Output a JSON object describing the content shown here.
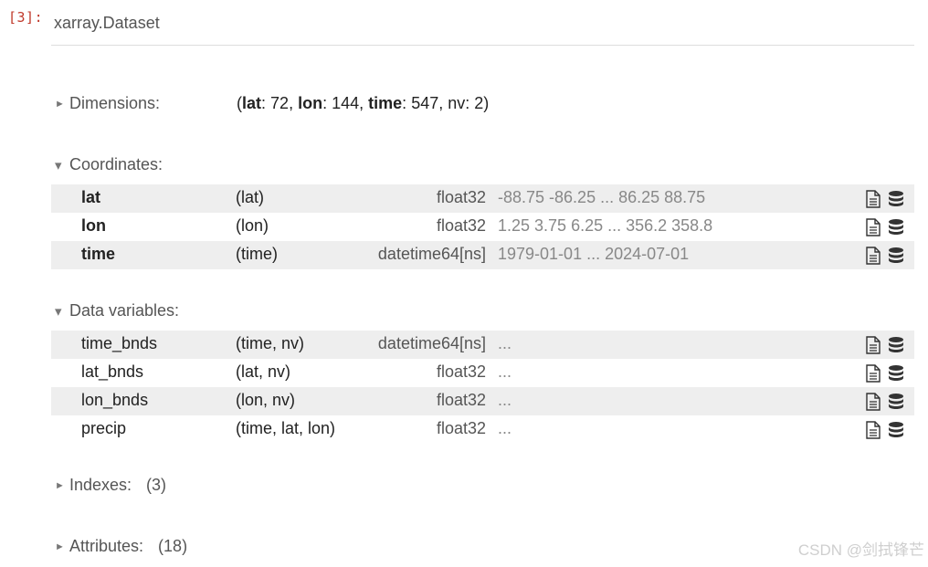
{
  "prompt": "[3]:",
  "dataset_title": "xarray.Dataset",
  "dimensions": {
    "label": "Dimensions:",
    "items": [
      {
        "name": "lat",
        "value": "72"
      },
      {
        "name": "lon",
        "value": "144"
      },
      {
        "name": "time",
        "value": "547"
      },
      {
        "name": "nv",
        "value": "2"
      }
    ]
  },
  "coordinates": {
    "label": "Coordinates:",
    "rows": [
      {
        "name": "lat",
        "dims": "(lat)",
        "dtype": "float32",
        "preview": "-88.75 -86.25 ... 86.25 88.75"
      },
      {
        "name": "lon",
        "dims": "(lon)",
        "dtype": "float32",
        "preview": "1.25 3.75 6.25 ... 356.2 358.8"
      },
      {
        "name": "time",
        "dims": "(time)",
        "dtype": "datetime64[ns]",
        "preview": "1979-01-01 ... 2024-07-01"
      }
    ]
  },
  "data_variables": {
    "label": "Data variables:",
    "rows": [
      {
        "name": "time_bnds",
        "dims": "(time, nv)",
        "dtype": "datetime64[ns]",
        "preview": "..."
      },
      {
        "name": "lat_bnds",
        "dims": "(lat, nv)",
        "dtype": "float32",
        "preview": "..."
      },
      {
        "name": "lon_bnds",
        "dims": "(lon, nv)",
        "dtype": "float32",
        "preview": "..."
      },
      {
        "name": "precip",
        "dims": "(time, lat, lon)",
        "dtype": "float32",
        "preview": "..."
      }
    ]
  },
  "indexes": {
    "label": "Indexes:",
    "count": "(3)"
  },
  "attributes": {
    "label": "Attributes:",
    "count": "(18)"
  },
  "watermark": "CSDN @剑拭锋芒",
  "colors": {
    "prompt": "#c0392b",
    "row_shade": "#eeeeee",
    "muted": "#888888"
  },
  "icons": {
    "doc": "file-text-icon",
    "db": "database-icon"
  }
}
